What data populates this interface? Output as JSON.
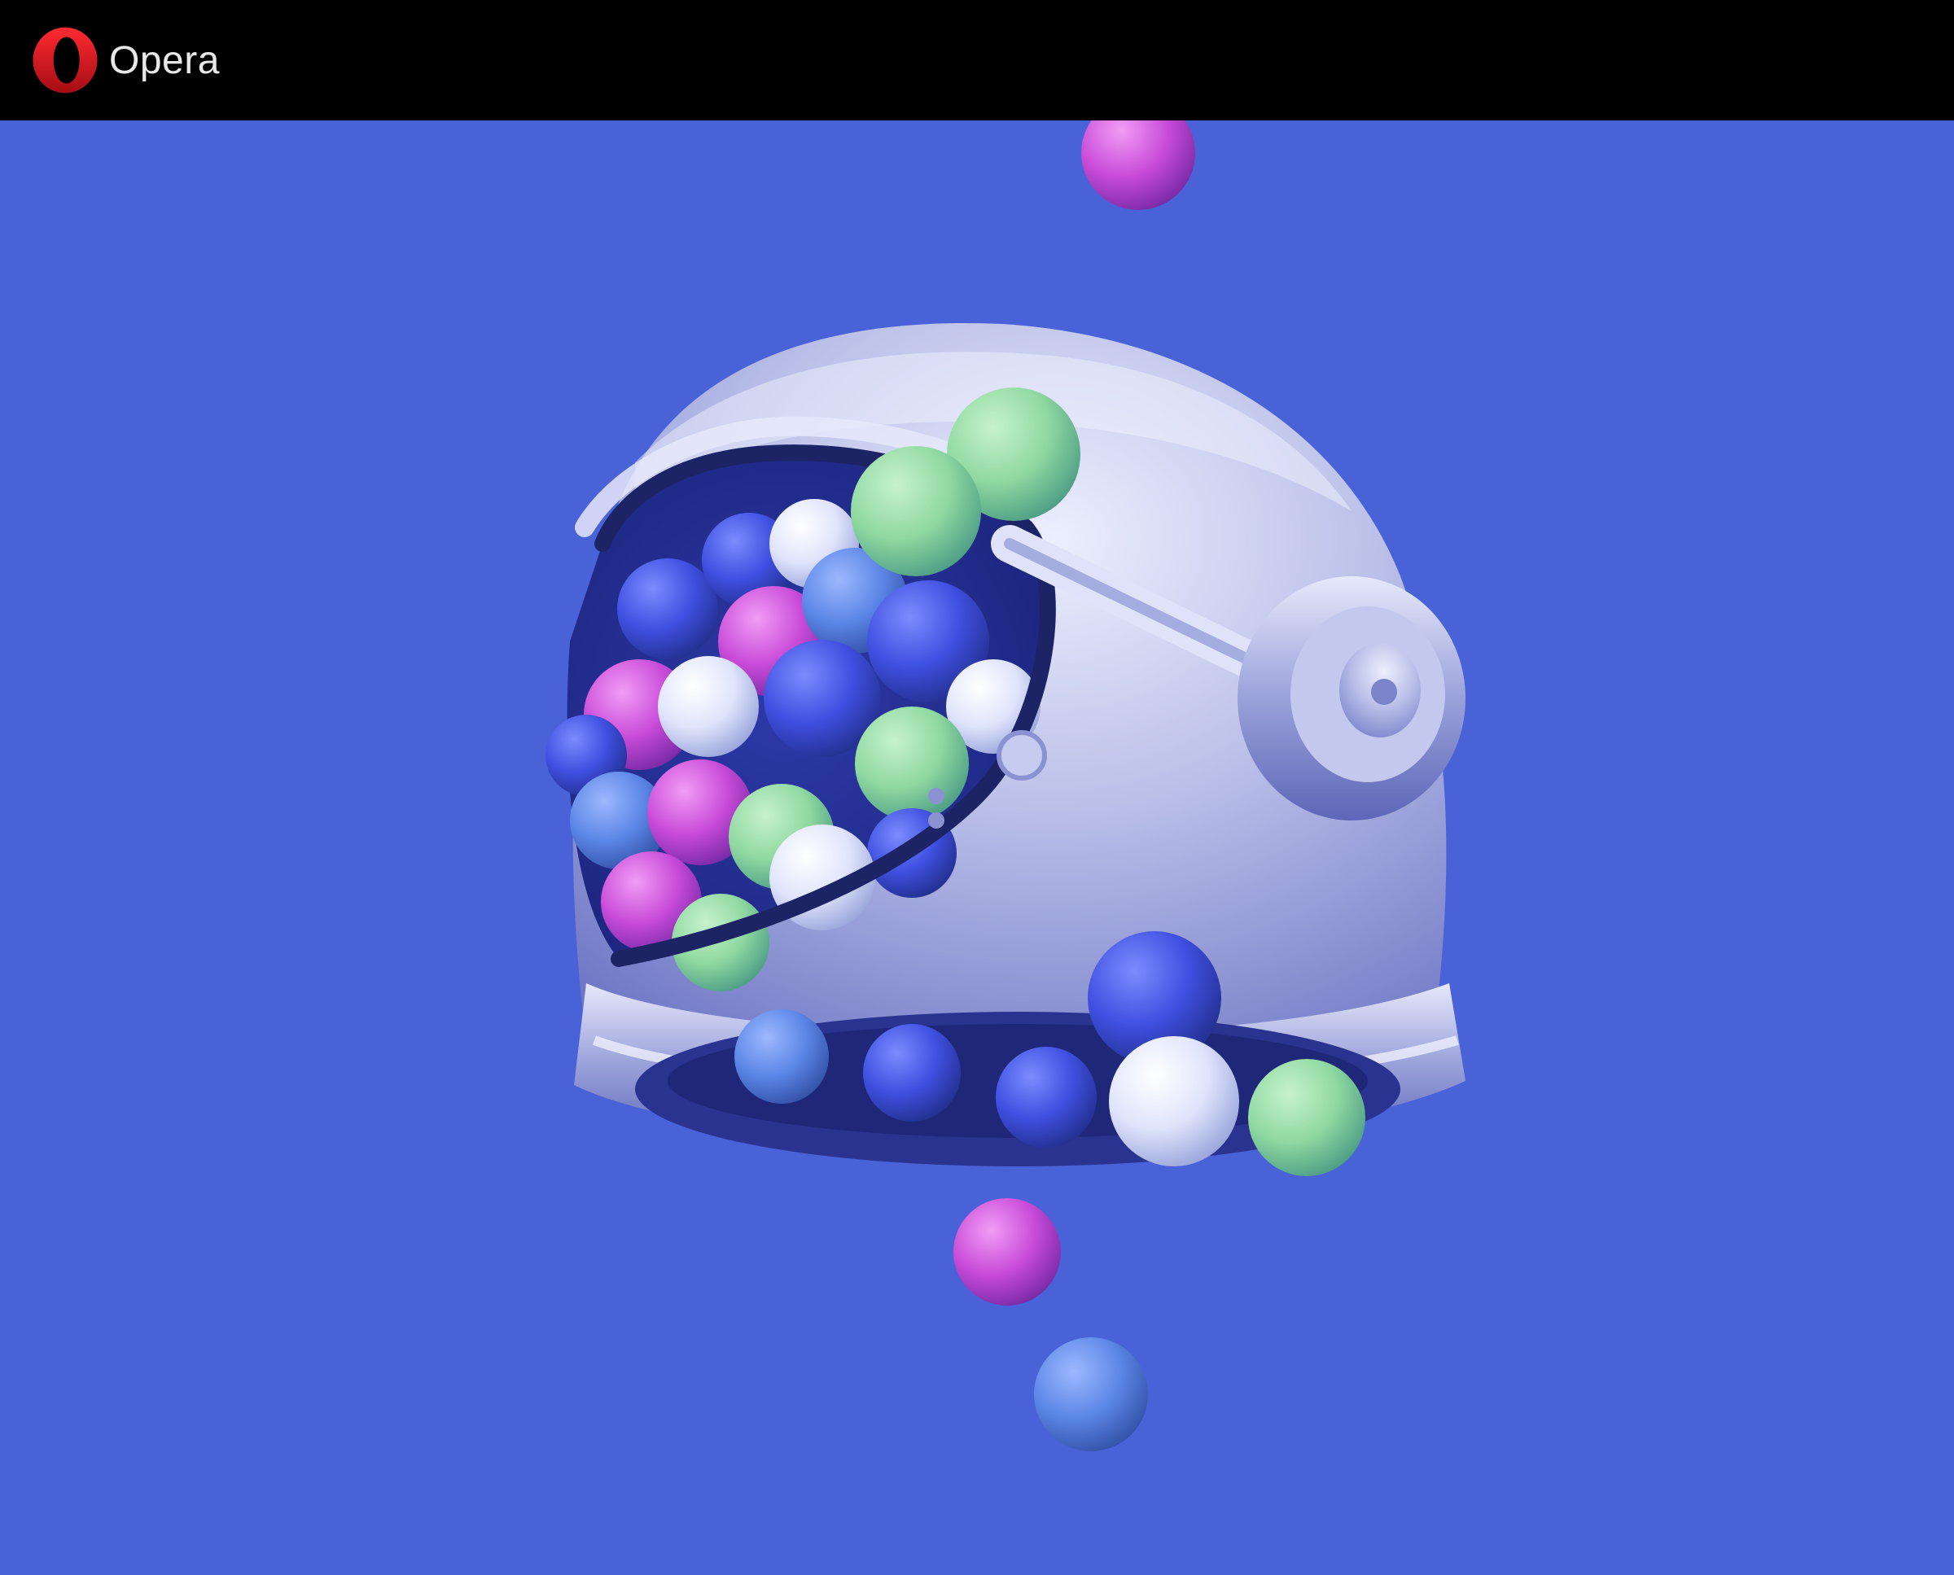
{
  "brand": {
    "name": "Opera",
    "logo_icon": "opera-logo-icon"
  },
  "hero": {
    "background_color": "#4a62d8",
    "illustration_icon": "astronaut-helmet-with-balls-icon"
  },
  "colors": {
    "topbar": "#000000",
    "logo_red": "#e0141e",
    "ball_green": "#8fd8a0",
    "ball_magenta": "#c84bd8",
    "ball_blue": "#3f4fe0",
    "ball_white": "#dfe4fb"
  }
}
